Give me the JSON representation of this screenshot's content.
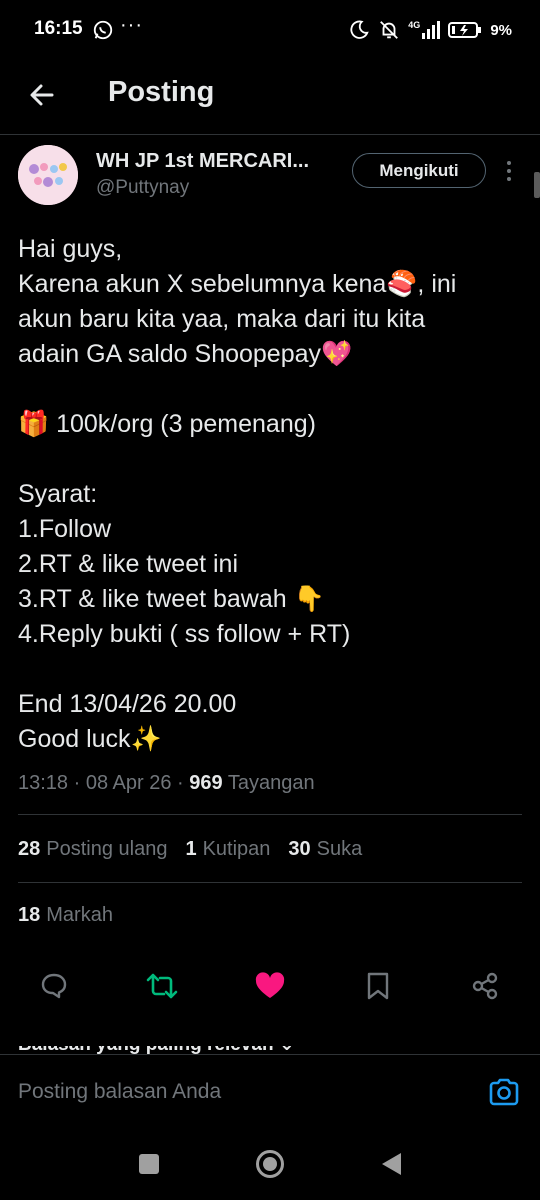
{
  "status_bar": {
    "time": "16:15",
    "more": "···",
    "battery_pct": "9%",
    "network": "4G"
  },
  "header": {
    "title": "Posting"
  },
  "author": {
    "name": "WH JP 1st MERCARI...",
    "handle": "@Puttynay",
    "follow_label": "Mengikuti"
  },
  "tweet": {
    "lines": [
      "Hai guys,",
      "Karena akun X sebelumnya kena🍣, ini",
      "akun baru kita yaa, maka dari itu kita",
      "adain GA saldo Shoopepay💖",
      "",
      "🎁 100k/org (3 pemenang)",
      "",
      "Syarat:",
      "1.Follow",
      "2.RT & like tweet ini",
      "3.RT & like tweet bawah 👇",
      "4.Reply bukti ( ss follow + RT)",
      "",
      "End 13/04/26 20.00",
      "Good luck✨"
    ],
    "time": "13:18",
    "date": "08 Apr 26",
    "views_count": "969",
    "views_label": "Tayangan"
  },
  "stats": {
    "reposts_count": "28",
    "reposts_label": "Posting ulang",
    "quotes_count": "1",
    "quotes_label": "Kutipan",
    "likes_count": "30",
    "likes_label": "Suka",
    "bookmarks_count": "18",
    "bookmarks_label": "Markah"
  },
  "replies_header_peek": "Balasan yang paling relevan ⌄",
  "reply": {
    "placeholder": "Posting balasan Anda"
  },
  "colors": {
    "background": "#000000",
    "text": "#e7e9ea",
    "muted": "#71767b",
    "repost_active": "#00ba7c",
    "like_active": "#f91880",
    "accent": "#1d9bf0",
    "divider": "#2f3336"
  },
  "icons": {
    "back": "arrow-left-icon",
    "more": "vertical-dots-icon",
    "reply": "comment-icon",
    "repost": "repost-icon",
    "like": "heart-icon",
    "bookmark": "bookmark-icon",
    "share": "share-icon",
    "camera": "camera-icon"
  }
}
